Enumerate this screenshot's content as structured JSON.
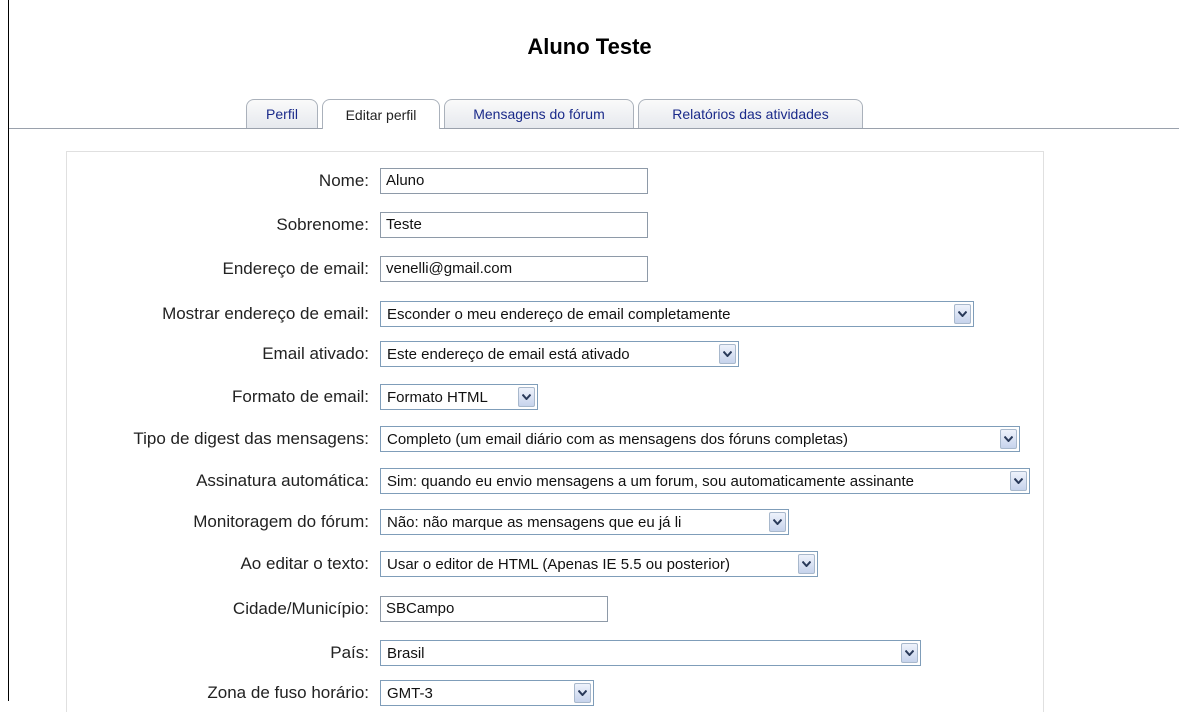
{
  "header": {
    "title": "Aluno Teste"
  },
  "tabs": [
    {
      "label": "Perfil",
      "active": false
    },
    {
      "label": "Editar perfil",
      "active": true
    },
    {
      "label": "Mensagens do fórum",
      "active": false
    },
    {
      "label": "Relatórios das atividades",
      "active": false
    }
  ],
  "form": {
    "nome": {
      "label": "Nome:",
      "value": "Aluno"
    },
    "sobrenome": {
      "label": "Sobrenome:",
      "value": "Teste"
    },
    "email": {
      "label": "Endereço de email:",
      "value": "venelli@gmail.com"
    },
    "mostrar_email": {
      "label": "Mostrar endereço de email:",
      "value": "Esconder o meu endereço de email completamente"
    },
    "email_ativado": {
      "label": "Email ativado:",
      "value": "Este endereço de email está ativado"
    },
    "formato_email": {
      "label": "Formato de email:",
      "value": "Formato HTML"
    },
    "digest": {
      "label": "Tipo de digest das mensagens:",
      "value": "Completo (um email diário com as mensagens dos fóruns completas)"
    },
    "assinatura": {
      "label": "Assinatura automática:",
      "value": "Sim: quando eu envio mensagens a um forum, sou automaticamente assinante"
    },
    "monitoragem": {
      "label": "Monitoragem do fórum:",
      "value": "Não: não marque as mensagens que eu já li"
    },
    "editor": {
      "label": "Ao editar o texto:",
      "value": "Usar o editor de HTML (Apenas IE 5.5 ou posterior)"
    },
    "cidade": {
      "label": "Cidade/Município:",
      "value": "SBCampo"
    },
    "pais": {
      "label": "País:",
      "value": "Brasil"
    },
    "fuso": {
      "label": "Zona de fuso horário:",
      "value": "GMT-3"
    }
  }
}
